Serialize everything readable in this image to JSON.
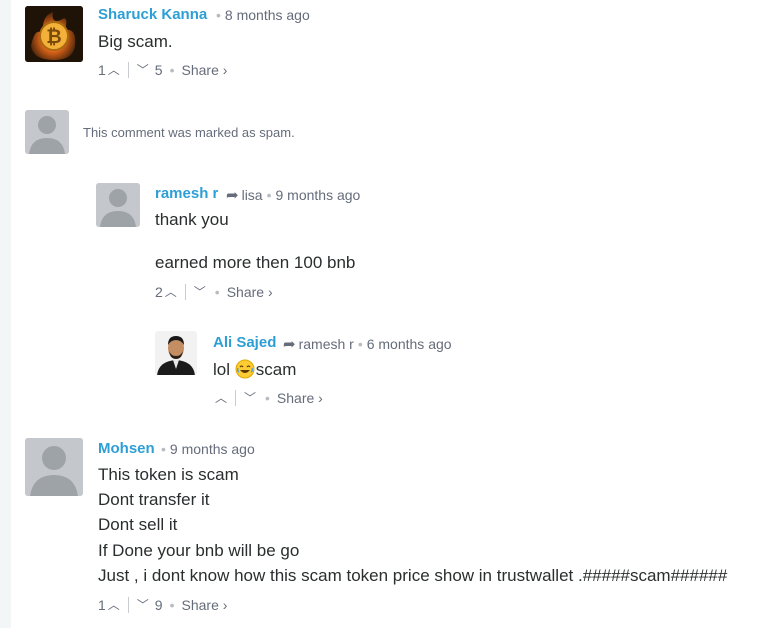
{
  "comments": [
    {
      "author": "Sharuck Kanna",
      "time": "8 months ago",
      "lines": [
        "Big scam."
      ],
      "upvotes": "1",
      "downvotes": "5",
      "share": "Share ›"
    },
    {
      "spam_text": "This comment was marked as spam."
    },
    {
      "author": "ramesh r",
      "reply_to": "lisa",
      "time": "9 months ago",
      "lines": [
        "thank you",
        "earned more then 100 bnb"
      ],
      "upvotes": "2",
      "share": "Share ›"
    },
    {
      "author": "Ali Sajed",
      "reply_to": "ramesh r",
      "time": "6 months ago",
      "text_before_emoji": "lol ",
      "text_after_emoji": "scam",
      "share": "Share ›"
    },
    {
      "author": "Mohsen",
      "time": "9 months ago",
      "lines": [
        "This token is scam",
        "Dont transfer it",
        "Dont sell it",
        "If Done your bnb will be go",
        "Just , i dont know how this scam token price show in trustwallet .#####scam######"
      ],
      "upvotes": "1",
      "downvotes": "9",
      "share": "Share ›"
    }
  ],
  "icons": {
    "upvote": "chevron-up-icon",
    "downvote": "chevron-down-icon",
    "reply_arrow": "reply-arrow-icon",
    "emoji": "laughing-emoji-icon"
  },
  "colors": {
    "author": "#2e9fd5",
    "meta": "#656c7a",
    "text": "#2a2e2e",
    "avatar_placeholder": "#c4c8cc"
  }
}
